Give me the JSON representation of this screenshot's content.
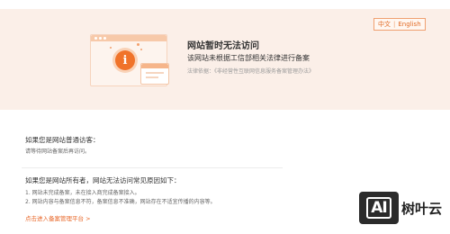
{
  "lang": {
    "chinese": "中文",
    "separator": "|",
    "english": "English"
  },
  "banner": {
    "title": "网站暂时无法访问",
    "subtitle": "该网站未根据工信部相关法律进行备案",
    "law_prefix": "法律依据：",
    "law_link": "《非经营性互联网信息服务备案管理办法》",
    "illustration_icon": "info-icon",
    "colors": {
      "banner_bg": "#fbefe8",
      "accent": "#f0732a"
    }
  },
  "visitor": {
    "title": "如果您是网站普通访客：",
    "text": "请等待网站备案后再访问。"
  },
  "owner": {
    "title": "如果您是网站所有者，网站无法访问常见原因如下：",
    "reasons": [
      "1. 网站未完成备案，未在接入商完成备案接入。",
      "2. 网站内容与备案信息不符，备案信息不准确，网站存在不适宜传播的内容等。"
    ]
  },
  "footer_link": "点击进入备案管理平台 >",
  "watermark": {
    "badge": "AI",
    "name": "树叶云"
  }
}
